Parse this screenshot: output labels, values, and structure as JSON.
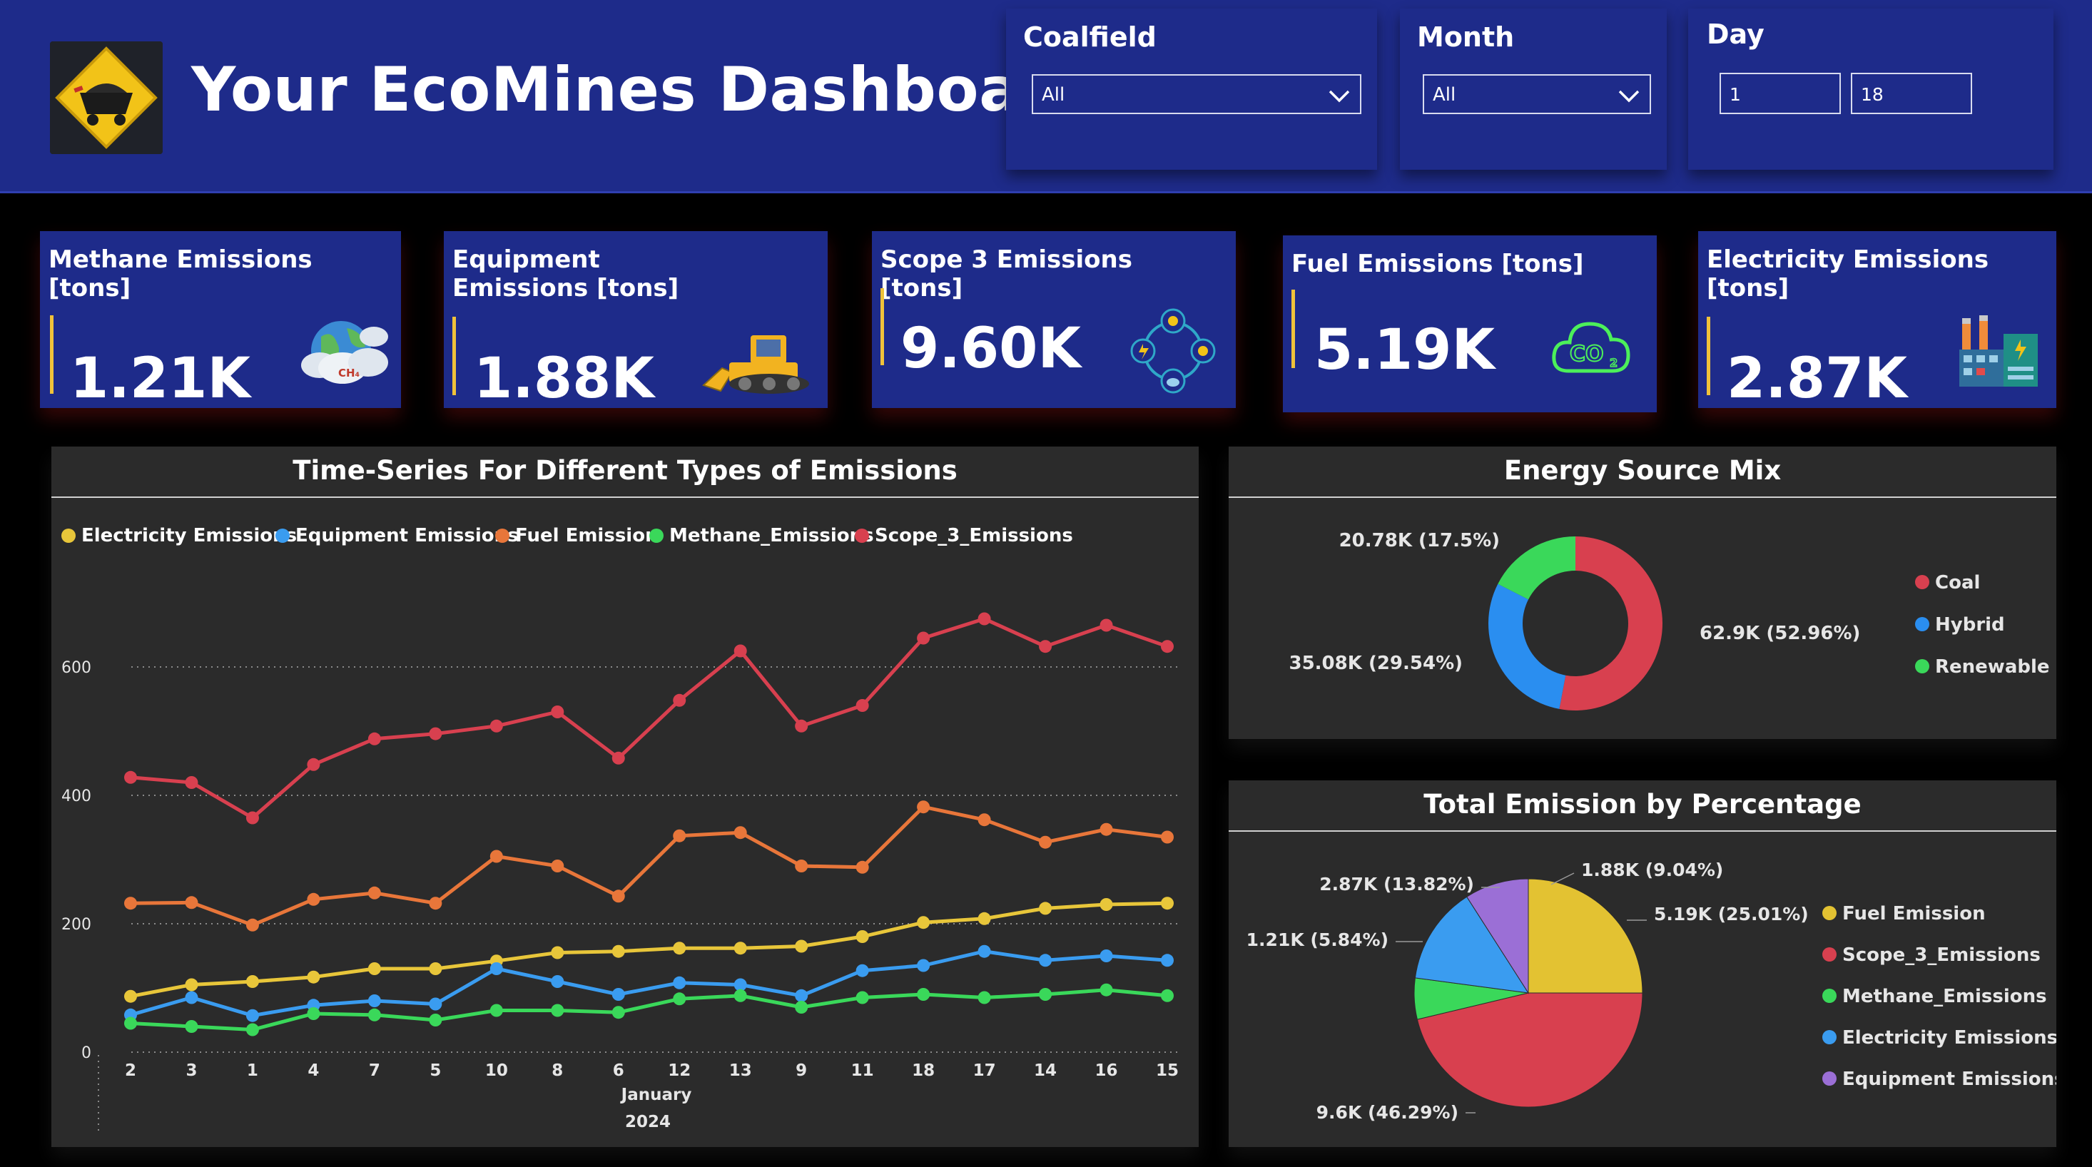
{
  "header": {
    "title": "Your EcoMines Dashboard",
    "logo_icon": "mining-cart-icon",
    "slicers": {
      "coalfield": {
        "label": "Coalfield",
        "value": "All"
      },
      "month": {
        "label": "Month",
        "value": "All"
      },
      "day": {
        "label": "Day",
        "from": "1",
        "to": "18"
      }
    }
  },
  "cards": [
    {
      "title": "Methane Emissions [tons]",
      "value": "1.21K",
      "icon": "methane-cloud-icon"
    },
    {
      "title": "Equipment Emissions [tons]",
      "value": "1.88K",
      "icon": "bulldozer-icon"
    },
    {
      "title": "Scope 3 Emissions [tons]",
      "value": "9.60K",
      "icon": "supply-chain-cycle-icon"
    },
    {
      "title": "Fuel Emissions [tons]",
      "value": "5.19K",
      "icon": "co2-cloud-icon"
    },
    {
      "title": "Electricity Emissions [tons]",
      "value": "2.87K",
      "icon": "factory-icon"
    }
  ],
  "timeseries": {
    "title": "Time-Series For Different Types of Emissions",
    "month_label": "January",
    "year_label": "2024",
    "legend": [
      {
        "name": "Electricity Emissions",
        "color": "#e8c63a"
      },
      {
        "name": "Equipment Emissions",
        "color": "#3a9cf0"
      },
      {
        "name": "Fuel Emission",
        "color": "#e8763a"
      },
      {
        "name": "Methane_Emissions",
        "color": "#3ad85a"
      },
      {
        "name": "Scope_3_Emissions",
        "color": "#d8404f"
      }
    ]
  },
  "chart_data": [
    {
      "type": "line",
      "title": "Time-Series For Different Types of Emissions",
      "categories": [
        "2",
        "3",
        "1",
        "4",
        "7",
        "5",
        "10",
        "8",
        "6",
        "12",
        "13",
        "9",
        "11",
        "18",
        "17",
        "14",
        "16",
        "15"
      ],
      "ylim": [
        0,
        700
      ],
      "yticks": [
        0,
        200,
        400,
        600
      ],
      "grid": true,
      "legend_position": "top-left",
      "series": [
        {
          "name": "Electricity Emissions",
          "color": "#e8c63a",
          "values": [
            87,
            105,
            110,
            117,
            130,
            130,
            142,
            155,
            157,
            162,
            162,
            165,
            180,
            202,
            208,
            224,
            230,
            232
          ]
        },
        {
          "name": "Equipment Emissions",
          "color": "#3a9cf0",
          "values": [
            58,
            85,
            57,
            73,
            80,
            75,
            130,
            110,
            90,
            108,
            105,
            88,
            127,
            135,
            157,
            143,
            150,
            143
          ]
        },
        {
          "name": "Fuel Emission",
          "color": "#e8763a",
          "values": [
            232,
            233,
            198,
            238,
            248,
            232,
            305,
            290,
            243,
            337,
            342,
            290,
            288,
            382,
            362,
            327,
            347,
            335
          ]
        },
        {
          "name": "Methane_Emissions",
          "color": "#3ad85a",
          "values": [
            45,
            40,
            35,
            60,
            58,
            50,
            65,
            65,
            62,
            83,
            88,
            70,
            85,
            90,
            85,
            90,
            97,
            88
          ]
        },
        {
          "name": "Scope_3_Emissions",
          "color": "#d8404f",
          "values": [
            428,
            420,
            365,
            448,
            488,
            496,
            508,
            530,
            458,
            548,
            625,
            508,
            540,
            645,
            675,
            632,
            665,
            632
          ]
        }
      ]
    },
    {
      "type": "pie",
      "title": "Energy Source Mix",
      "donut": true,
      "legend_position": "right",
      "slices": [
        {
          "name": "Coal",
          "value": 62.9,
          "label": "62.9K (52.96%)",
          "color": "#d8404f"
        },
        {
          "name": "Hybrid",
          "value": 35.08,
          "label": "35.08K (29.54%)",
          "color": "#2a8ef0"
        },
        {
          "name": "Renewable",
          "value": 20.78,
          "label": "20.78K (17.5%)",
          "color": "#3ad85a"
        }
      ]
    },
    {
      "type": "pie",
      "title": "Total Emission by Percentage",
      "legend_position": "right",
      "slices": [
        {
          "name": "Fuel Emission",
          "value": 5.19,
          "label": "5.19K (25.01%)",
          "color": "#e3c232"
        },
        {
          "name": "Scope_3_Emissions",
          "value": 9.6,
          "label": "9.6K (46.29%)",
          "color": "#d8404f"
        },
        {
          "name": "Methane_Emissions",
          "value": 1.21,
          "label": "1.21K (5.84%)",
          "color": "#3ad85a"
        },
        {
          "name": "Electricity Emissions",
          "value": 2.87,
          "label": "2.87K (13.82%)",
          "color": "#3a9cf0"
        },
        {
          "name": "Equipment Emissions",
          "value": 1.88,
          "label": "1.88K (9.04%)",
          "color": "#9b6fd6"
        }
      ]
    }
  ]
}
